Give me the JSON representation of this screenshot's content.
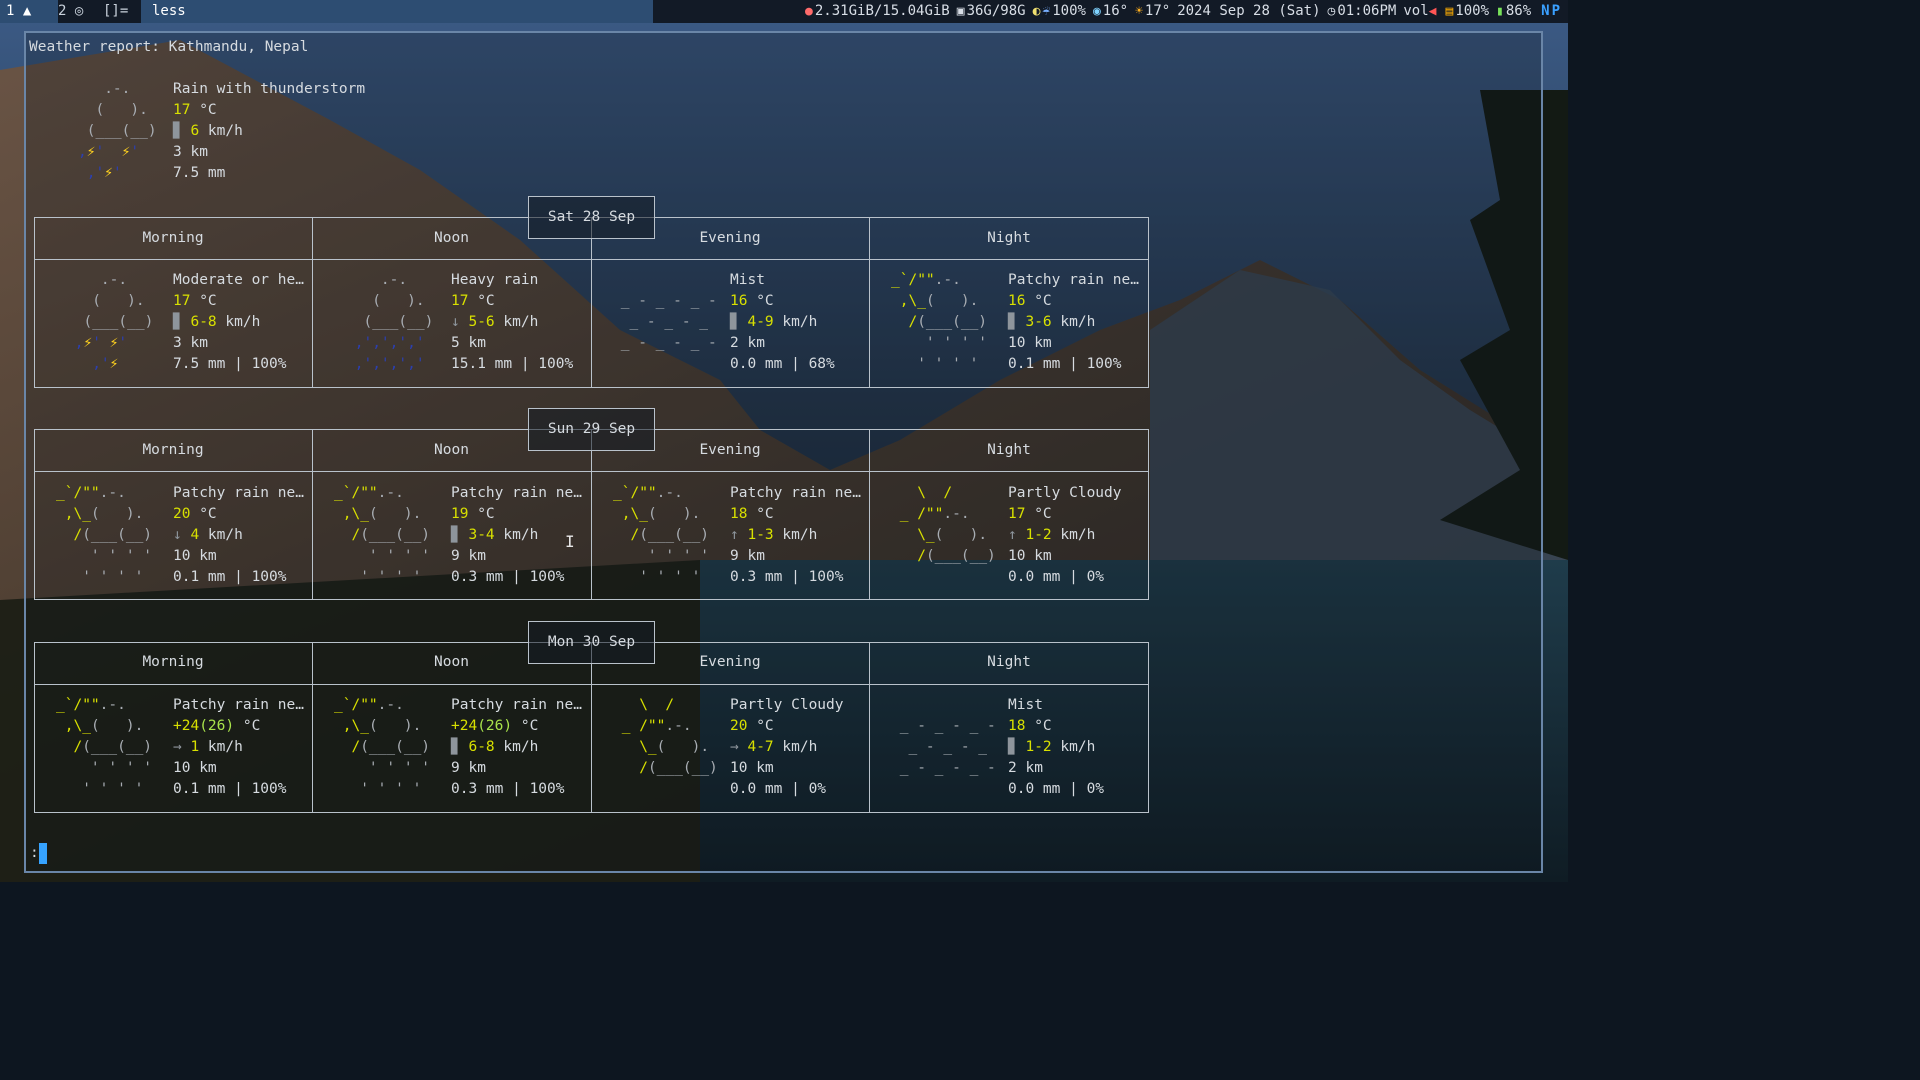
{
  "topbar": {
    "workspaces": [
      {
        "num": "1",
        "icon": "▲"
      },
      {
        "num": "2",
        "icon": "◎"
      }
    ],
    "layout": "[]=",
    "window_title": "less",
    "status": {
      "memory": "2.31GiB/15.04GiB",
      "disk": "36G/98G",
      "brightness": "100%",
      "temp1": "16°",
      "temp2": "17°",
      "date": "2024 Sep 28 (Sat)",
      "time": "01:06PM",
      "vol_label": "vol",
      "wifi": "100%",
      "battery": "86%",
      "kb_layout": "NP"
    },
    "colors": {
      "bar_bg": "#121a26",
      "active_bg": "#2d4d72",
      "accent": "#3aa0ff"
    }
  },
  "weather": {
    "heading": "Weather report: Kathmandu, Nepal",
    "current": {
      "cond": "Rain with thunderstorm",
      "temp_value": "17",
      "temp_unit": " °C",
      "wind_icon": "▊",
      "wind_value": "6",
      "wind_unit": " km/h",
      "visibility": "3 km",
      "precip": "7.5 mm"
    },
    "days": [
      {
        "label": "Sat 28 Sep",
        "periods": [
          {
            "name": "Morning",
            "cond": "Moderate or he…",
            "t1": "17",
            "t2": "",
            "unit": " °C",
            "wdir": "▊",
            "wind": "6-8",
            "wunit": " km/h",
            "vis": "3 km",
            "precip": "7.5 mm | 100%"
          },
          {
            "name": "Noon",
            "cond": "Heavy rain",
            "t1": "17",
            "t2": "",
            "unit": " °C",
            "wdir": "↓",
            "wind": "5-6",
            "wunit": " km/h",
            "vis": "5 km",
            "precip": "15.1 mm | 100%"
          },
          {
            "name": "Evening",
            "cond": "Mist",
            "t1": "16",
            "t2": "",
            "unit": " °C",
            "wdir": "▊",
            "wind": "4-9",
            "wunit": " km/h",
            "vis": "2 km",
            "precip": "0.0 mm | 68%"
          },
          {
            "name": "Night",
            "cond": "Patchy rain ne…",
            "t1": "16",
            "t2": "",
            "unit": " °C",
            "wdir": "▊",
            "wind": "3-6",
            "wunit": " km/h",
            "vis": "10 km",
            "precip": "0.1 mm | 100%"
          }
        ]
      },
      {
        "label": "Sun 29 Sep",
        "periods": [
          {
            "name": "Morning",
            "cond": "Patchy rain ne…",
            "t1": "20",
            "t2": "",
            "unit": " °C",
            "wdir": "↓",
            "wind": "4",
            "wunit": " km/h",
            "vis": "10 km",
            "precip": "0.1 mm | 100%"
          },
          {
            "name": "Noon",
            "cond": "Patchy rain ne…",
            "t1": "19",
            "t2": "",
            "unit": " °C",
            "wdir": "▊",
            "wind": "3-4",
            "wunit": " km/h",
            "vis": "9 km",
            "precip": "0.3 mm | 100%"
          },
          {
            "name": "Evening",
            "cond": "Patchy rain ne…",
            "t1": "18",
            "t2": "",
            "unit": " °C",
            "wdir": "↑",
            "wind": "1-3",
            "wunit": " km/h",
            "vis": "9 km",
            "precip": "0.3 mm | 100%"
          },
          {
            "name": "Night",
            "cond": "Partly Cloudy",
            "t1": "17",
            "t2": "",
            "unit": " °C",
            "wdir": "↑",
            "wind": "1-2",
            "wunit": " km/h",
            "vis": "10 km",
            "precip": "0.0 mm | 0%"
          }
        ]
      },
      {
        "label": "Mon 30 Sep",
        "periods": [
          {
            "name": "Morning",
            "cond": "Patchy rain ne…",
            "t1": "+24",
            "t2": "(26)",
            "unit": " °C",
            "wdir": "→",
            "wind": "1",
            "wunit": " km/h",
            "vis": "10 km",
            "precip": "0.1 mm | 100%"
          },
          {
            "name": "Noon",
            "cond": "Patchy rain ne…",
            "t1": "+24",
            "t2": "(26)",
            "unit": " °C",
            "wdir": "▊",
            "wind": "6-8",
            "wunit": " km/h",
            "vis": "9 km",
            "precip": "0.3 mm | 100%"
          },
          {
            "name": "Evening",
            "cond": "Partly Cloudy",
            "t1": "20",
            "t2": "",
            "unit": " °C",
            "wdir": "→",
            "wind": "4-7",
            "wunit": " km/h",
            "vis": "10 km",
            "precip": "0.0 mm | 0%"
          },
          {
            "name": "Night",
            "cond": "Mist",
            "t1": "18",
            "t2": "",
            "unit": " °C",
            "wdir": "▊",
            "wind": "1-2",
            "wunit": " km/h",
            "vis": "2 km",
            "precip": "0.0 mm | 0%"
          }
        ]
      }
    ],
    "prompt": ":"
  }
}
